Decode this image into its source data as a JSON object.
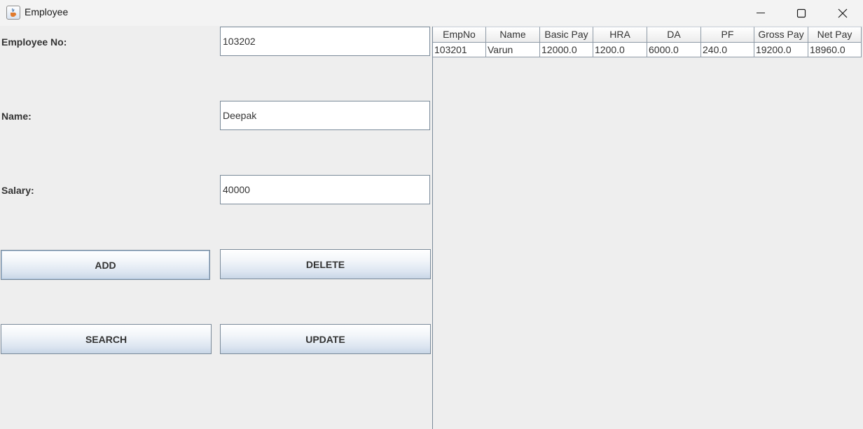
{
  "window": {
    "title": "Employee",
    "icon": "java-cup-icon",
    "controls": [
      "minimize-icon",
      "maximize-icon",
      "close-icon"
    ]
  },
  "form": {
    "employee_no": {
      "label": "Employee No:",
      "value": "103202"
    },
    "name": {
      "label": "Name:",
      "value": "Deepak"
    },
    "salary": {
      "label": "Salary:",
      "value": "40000"
    }
  },
  "buttons": {
    "add": "ADD",
    "delete": "DELETE",
    "search": "SEARCH",
    "update": "UPDATE"
  },
  "table": {
    "columns": [
      "EmpNo",
      "Name",
      "Basic Pay",
      "HRA",
      "DA",
      "PF",
      "Gross Pay",
      "Net Pay"
    ],
    "rows": [
      [
        "103201",
        "Varun",
        "12000.0",
        "1200.0",
        "6000.0",
        "240.0",
        "19200.0",
        "18960.0"
      ]
    ]
  }
}
